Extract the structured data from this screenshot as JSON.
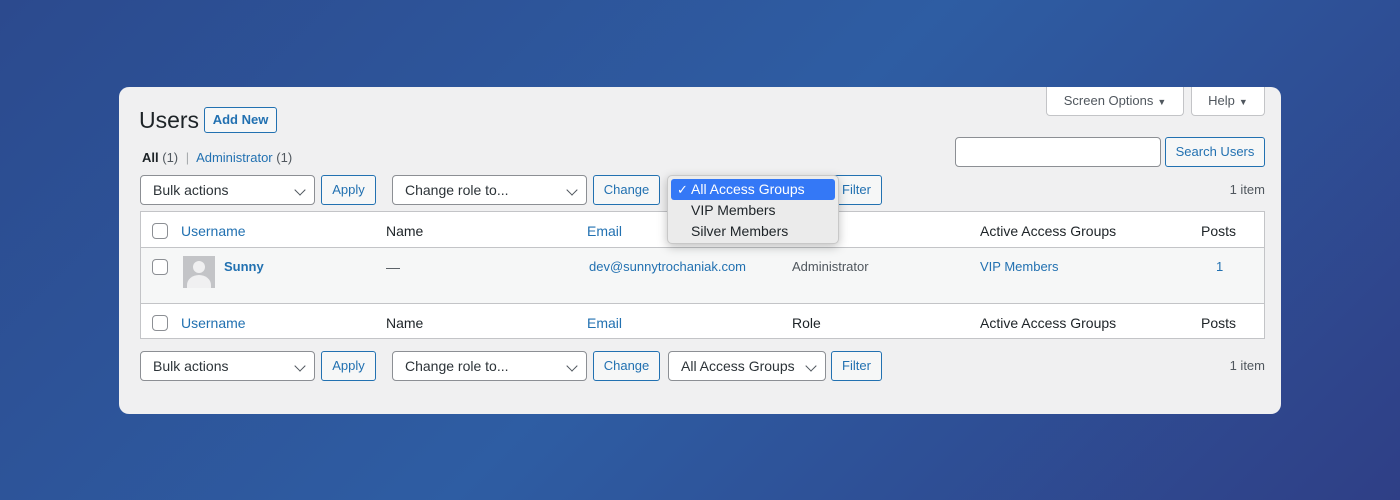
{
  "header": {
    "title": "Users",
    "add_new_label": "Add New",
    "screen_options_label": "Screen Options",
    "help_label": "Help"
  },
  "filters": {
    "all_label": "All",
    "all_count": "(1)",
    "separator": "|",
    "admin_label": "Administrator",
    "admin_count": "(1)"
  },
  "search": {
    "value": "",
    "button_label": "Search Users"
  },
  "tablenav_top": {
    "bulk_actions": "Bulk actions",
    "apply_label": "Apply",
    "change_role": "Change role to...",
    "change_label": "Change",
    "filter_label": "Filter",
    "item_count": "1 item"
  },
  "dropdown": {
    "check": "✓",
    "options": [
      "All Access Groups",
      "VIP Members",
      "Silver Members"
    ],
    "selected_index": 0
  },
  "table": {
    "columns": [
      "Username",
      "Name",
      "Email",
      "Role",
      "Active Access Groups",
      "Posts"
    ],
    "rows": [
      {
        "username": "Sunny",
        "name": "—",
        "email": "dev@sunnytrochaniak.com",
        "role": "Administrator",
        "access_groups": "VIP Members",
        "posts": "1"
      }
    ]
  },
  "tablenav_bottom": {
    "bulk_actions": "Bulk actions",
    "apply_label": "Apply",
    "change_role": "Change role to...",
    "change_label": "Change",
    "access_group_select": "All Access Groups",
    "filter_label": "Filter",
    "item_count": "1 item"
  },
  "colors": {
    "accent": "#2271b1",
    "panel_bg": "#f0f0f1",
    "dropdown_selected": "#3478f6"
  }
}
